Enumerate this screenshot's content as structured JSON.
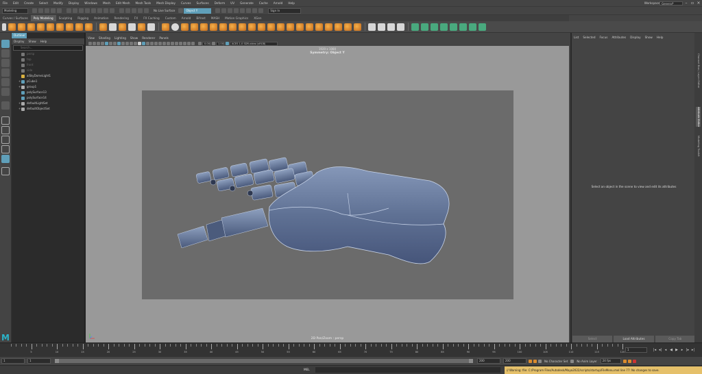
{
  "menu": [
    "File",
    "Edit",
    "Create",
    "Select",
    "Modify",
    "Display",
    "Windows",
    "Mesh",
    "Edit Mesh",
    "Mesh Tools",
    "Mesh Display",
    "Curves",
    "Surfaces",
    "Deform",
    "UV",
    "Generate",
    "Cache",
    "Arnold",
    "Help"
  ],
  "workspace": {
    "label": "Workspace:",
    "value": "General*"
  },
  "status": {
    "mode": "Modeling",
    "live_surface": "No Live Surface",
    "symmetry_field": "Object Y",
    "sign_in": "Sign In"
  },
  "shelf_tabs": [
    "Curves / Surfaces",
    "Poly Modeling",
    "Sculpting",
    "Rigging",
    "Animation",
    "Rendering",
    "FX",
    "FX Caching",
    "Custom",
    "Arnold",
    "Bifrost",
    "MASH",
    "Motion Graphics",
    "XGen"
  ],
  "shelf_active": "Poly Modeling",
  "outliner": {
    "title": "Outliner",
    "menu": [
      "Display",
      "Show",
      "Help"
    ],
    "search_placeholder": "Search...",
    "items": [
      {
        "label": "persp",
        "dim": true,
        "color": "#777777"
      },
      {
        "label": "top",
        "dim": true,
        "color": "#777777"
      },
      {
        "label": "front",
        "dim": true,
        "color": "#777777"
      },
      {
        "label": "side",
        "dim": true,
        "color": "#777777"
      },
      {
        "label": "aiSkyDomeLight1",
        "dim": false,
        "color": "#d8b040"
      },
      {
        "label": "pCube1",
        "dim": false,
        "color": "#5f9fb9",
        "expand": true
      },
      {
        "label": "group1",
        "dim": false,
        "color": "#b0b0b0",
        "expand": true
      },
      {
        "label": "polySurface13",
        "dim": false,
        "color": "#5f9fb9"
      },
      {
        "label": "polySurface14",
        "dim": false,
        "color": "#5f9fb9"
      },
      {
        "label": "defaultLightSet",
        "dim": false,
        "color": "#aaaaaa",
        "expand": true
      },
      {
        "label": "defaultObjectSet",
        "dim": false,
        "color": "#aaaaaa",
        "expand": true
      }
    ]
  },
  "viewport": {
    "menu": [
      "View",
      "Shading",
      "Lighting",
      "Show",
      "Renderer",
      "Panels"
    ],
    "field_a": "0.00",
    "field_b": "1.00",
    "colorspace": "ACES 1.0 SDR-video (sRGB)",
    "resolution": "1920 x 1080",
    "symmetry": "Symmetry: Object Y",
    "camera": "2D Pan/Zoom : persp"
  },
  "attribute_editor": {
    "menu": [
      "List",
      "Selected",
      "Focus",
      "Attributes",
      "Display",
      "Show",
      "Help"
    ],
    "message": "Select an object in the scene to view and edit its attributes",
    "buttons": [
      "Select",
      "Load Attributes",
      "Copy Tab"
    ],
    "side_tabs": [
      "Channel Box / Layer Editor",
      "Attribute Editor",
      "Modeling Toolkit"
    ]
  },
  "timeline": {
    "labels": [
      "5",
      "10",
      "15",
      "20",
      "25",
      "30",
      "35",
      "40",
      "45",
      "50",
      "55",
      "60",
      "65",
      "70",
      "75",
      "80",
      "85",
      "90",
      "95",
      "100",
      "105",
      "110",
      "115",
      "120"
    ],
    "current": "1"
  },
  "range": {
    "start": "1",
    "start_inner": "1",
    "left_val": "1",
    "end_inner": "200",
    "end": "200",
    "end_total": "200",
    "character": "No Character Set",
    "anim_layer": "No Anim Layer",
    "fps": "24 fps"
  },
  "command": {
    "label": "MEL",
    "warning": "// Warning: file: C:/Program Files/Autodesk/Maya2022/scripts/startup/FileMenu.mel line 77: No changes to save."
  },
  "chart_data": null
}
